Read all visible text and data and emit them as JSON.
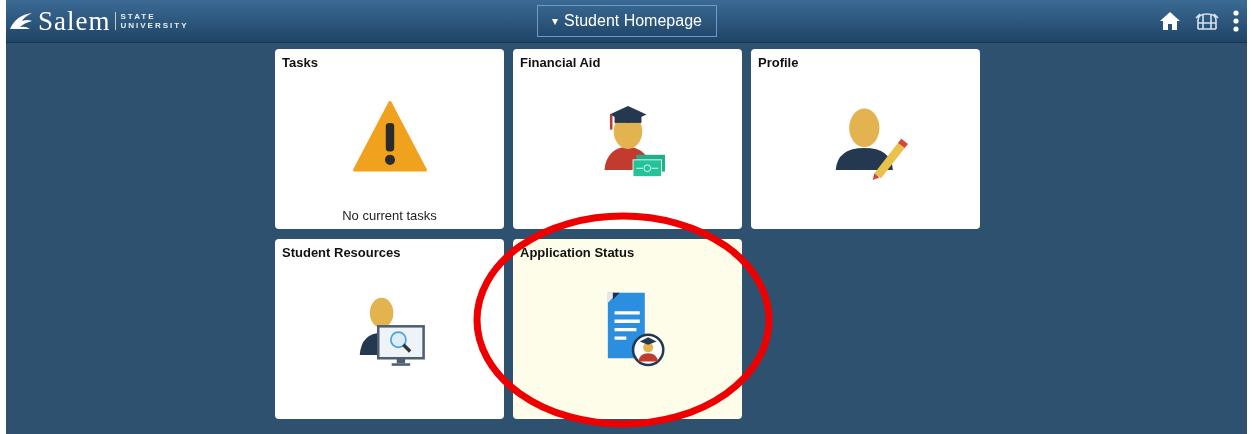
{
  "header": {
    "logo": {
      "name": "Salem",
      "subtitle": "STATE UNIVERSITY"
    },
    "title": {
      "caret": "▾",
      "label": "Student Homepage"
    },
    "actions": [
      {
        "kind": "home"
      },
      {
        "kind": "navbar"
      },
      {
        "kind": "menu"
      }
    ]
  },
  "tiles": [
    {
      "title": "Tasks",
      "kind": "warning",
      "footer": "No current tasks",
      "selected": false,
      "circled": false
    },
    {
      "title": "Financial Aid",
      "kind": "graduate",
      "selected": false,
      "circled": false
    },
    {
      "title": "Profile",
      "kind": "profile",
      "selected": false,
      "circled": false
    },
    {
      "title": "Student Resources",
      "kind": "search",
      "selected": false,
      "circled": false
    },
    {
      "title": "Application Status",
      "kind": "document",
      "selected": true,
      "circled": true
    }
  ]
}
